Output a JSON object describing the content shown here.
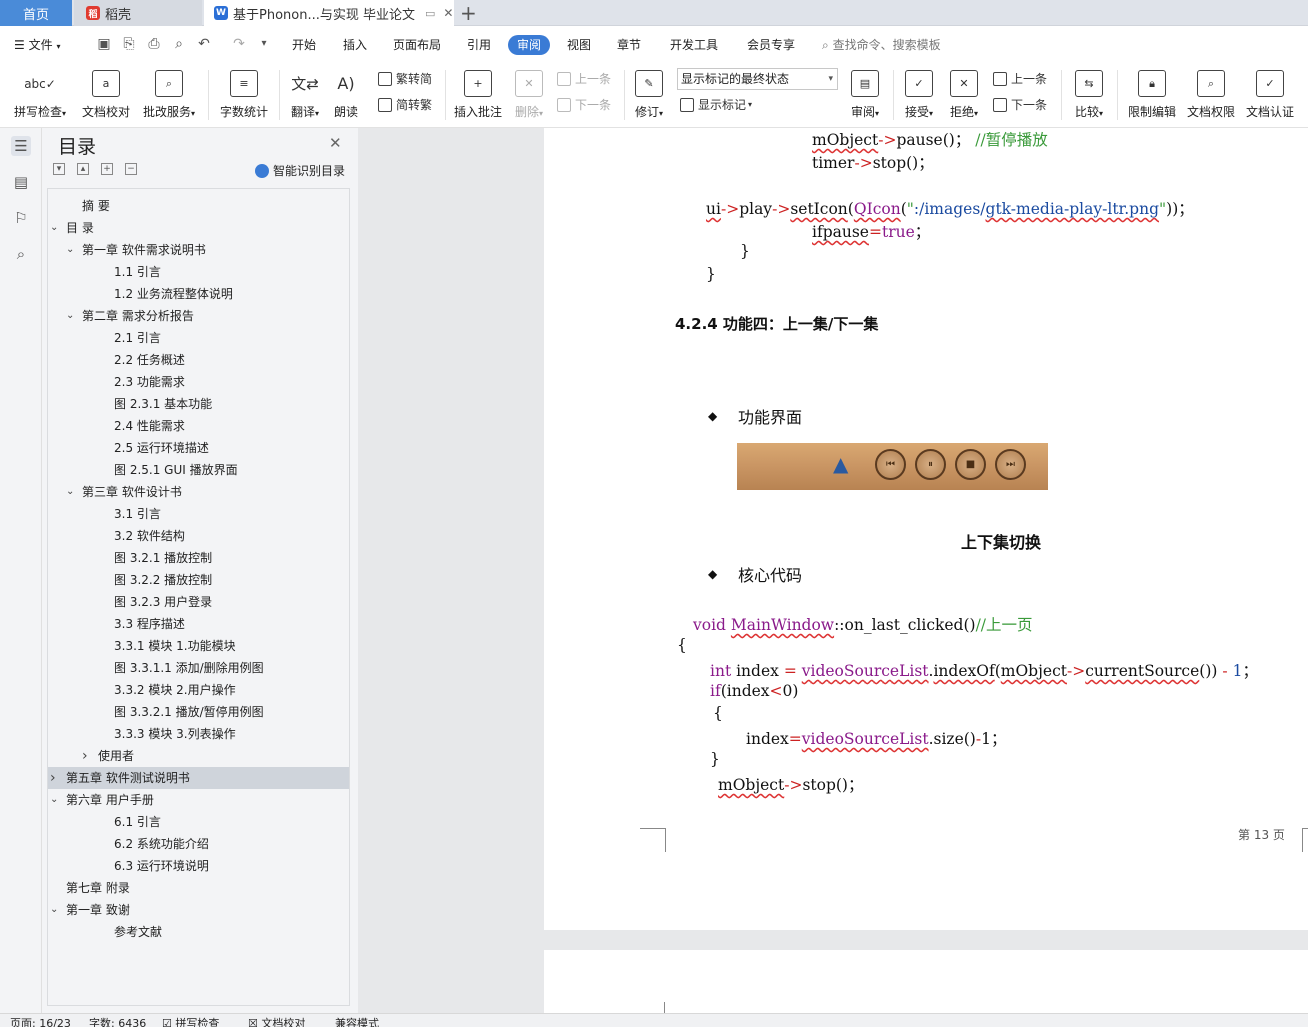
{
  "tabs": {
    "home": "首页",
    "daoke": "稻壳",
    "doc": "基于Phonon...与实现 毕业论文"
  },
  "menu": {
    "file": "文件",
    "items": [
      "开始",
      "插入",
      "页面布局",
      "引用",
      "审阅",
      "视图",
      "章节",
      "开发工具",
      "会员专享"
    ],
    "search": "查找命令、搜索模板"
  },
  "ribbon": {
    "spell": "拼写检查",
    "proof": "文档校对",
    "batch": "批改服务",
    "wordcount": "字数统计",
    "translate": "翻译",
    "read": "朗读",
    "trad": "繁转简",
    "simp": "简转繁",
    "insert_comment": "插入批注",
    "delete": "删除",
    "prev_comment": "上一条",
    "next_comment": "下一条",
    "revise": "修订",
    "markup_state": "显示标记的最终状态",
    "show_markup": "显示标记",
    "review": "审阅",
    "accept": "接受",
    "reject": "拒绝",
    "prev_change": "上一条",
    "next_change": "下一条",
    "compare": "比较",
    "restrict": "限制编辑",
    "rights": "文档权限",
    "certify": "文档认证"
  },
  "toc": {
    "title": "目录",
    "smart": "智能识别目录",
    "items": [
      {
        "label": "摘  要",
        "level": 1,
        "chev": ""
      },
      {
        "label": "目  录",
        "level": 0,
        "chev": "down"
      },
      {
        "label": "第一章  软件需求说明书",
        "level": 1,
        "chev": "down"
      },
      {
        "label": "1.1 引言",
        "level": 2,
        "chev": ""
      },
      {
        "label": "1.2 业务流程整体说明",
        "level": 2,
        "chev": ""
      },
      {
        "label": "第二章  需求分析报告",
        "level": 1,
        "chev": "down"
      },
      {
        "label": "2.1 引言",
        "level": 2,
        "chev": ""
      },
      {
        "label": "2.2 任务概述",
        "level": 2,
        "chev": ""
      },
      {
        "label": "2.3 功能需求",
        "level": 2,
        "chev": ""
      },
      {
        "label": "图 2.3.1  基本功能",
        "level": 2,
        "chev": ""
      },
      {
        "label": "2.4 性能需求",
        "level": 2,
        "chev": ""
      },
      {
        "label": "2.5 运行环境描述",
        "level": 2,
        "chev": ""
      },
      {
        "label": "图 2.5.1  GUI 播放界面",
        "level": 2,
        "chev": ""
      },
      {
        "label": "第三章  软件设计书",
        "level": 1,
        "chev": "down"
      },
      {
        "label": "3.1 引言",
        "level": 2,
        "chev": ""
      },
      {
        "label": "3.2 软件结构",
        "level": 2,
        "chev": ""
      },
      {
        "label": "图 3.2.1  播放控制",
        "level": 2,
        "chev": ""
      },
      {
        "label": "图 3.2.2  播放控制",
        "level": 2,
        "chev": ""
      },
      {
        "label": "图 3.2.3  用户登录",
        "level": 2,
        "chev": ""
      },
      {
        "label": "3.3 程序描述",
        "level": 2,
        "chev": ""
      },
      {
        "label": "3.3.1 模块 1.功能模块",
        "level": 2,
        "chev": ""
      },
      {
        "label": "图 3.3.1.1  添加/删除用例图",
        "level": 2,
        "chev": ""
      },
      {
        "label": "3.3.2 模块 2.用户操作",
        "level": 2,
        "chev": ""
      },
      {
        "label": "图 3.3.2.1  播放/暂停用例图",
        "level": 2,
        "chev": ""
      },
      {
        "label": "3.3.3 模块 3.列表操作",
        "level": 2,
        "chev": ""
      },
      {
        "label": "使用者",
        "level": 15,
        "chev": "right"
      },
      {
        "label": "第五章  软件测试说明书",
        "level": 0,
        "chev": "right",
        "selected": true
      },
      {
        "label": "第六章  用户手册",
        "level": 0,
        "chev": "down"
      },
      {
        "label": "6.1 引言",
        "level": 2,
        "chev": ""
      },
      {
        "label": "6.2 系统功能介绍",
        "level": 2,
        "chev": ""
      },
      {
        "label": "6.3 运行环境说明",
        "level": 2,
        "chev": ""
      },
      {
        "label": "第七章  附录",
        "level": 0,
        "chev": ""
      },
      {
        "label": "第一章  致谢",
        "level": 0,
        "chev": "down"
      },
      {
        "label": "参考文献",
        "level": 2,
        "chev": ""
      }
    ]
  },
  "doc": {
    "heading": "4.2.4  功能四：上一集/下一集",
    "bullet1": "功能界面",
    "caption": "上下集切换",
    "bullet2": "核心代码",
    "page_num": "第 13 页"
  },
  "status": {
    "page": "页面: 16/23",
    "words": "字数: 6436",
    "spell": "拼写检查",
    "proof": "文档校对",
    "compat": "兼容模式"
  },
  "colors": {
    "accent": "#3a7bd5",
    "comment_green": "#3a9a3a"
  }
}
